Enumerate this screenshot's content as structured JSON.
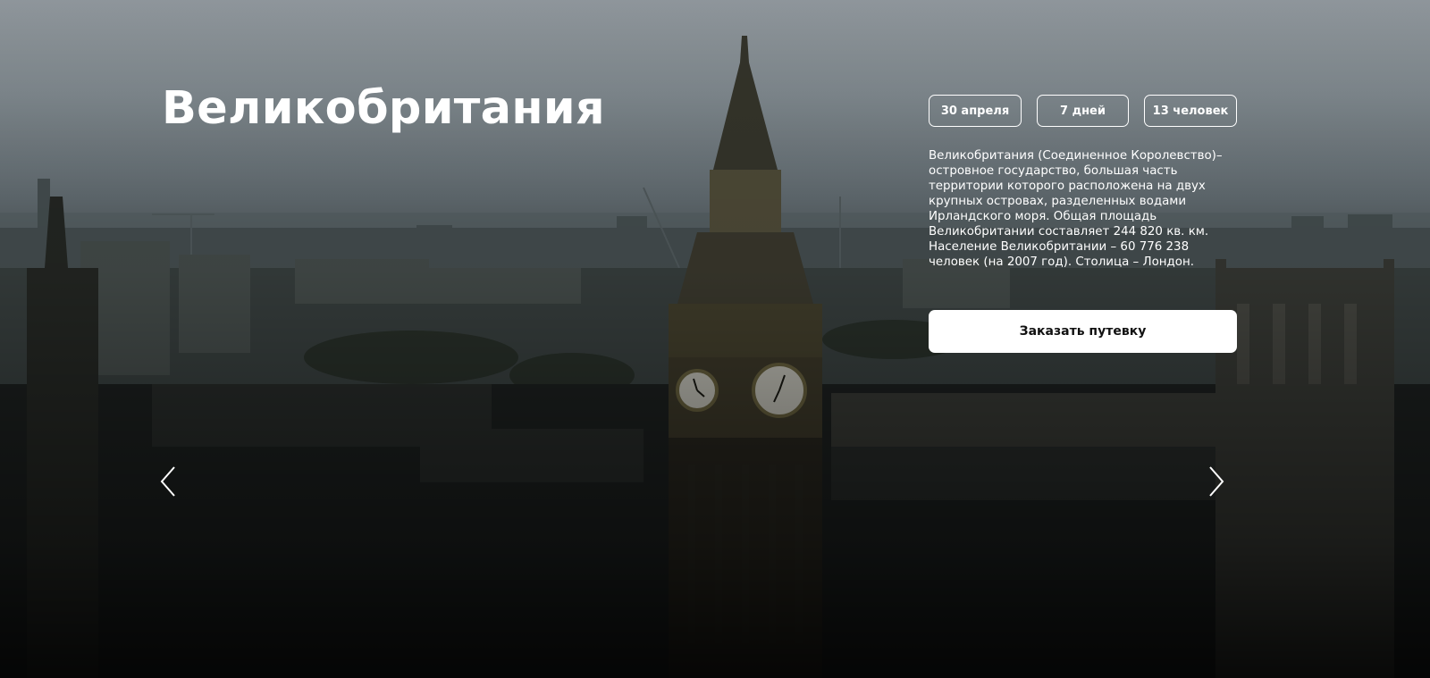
{
  "hero": {
    "title": "Великобритания",
    "badges": {
      "date": "30 апреля",
      "duration": "7 дней",
      "people": "13 человек"
    },
    "description": "Великобритания (Соединенное Королевство)– островное государство, большая часть территории которого расположена на двух крупных островах, разделенных водами Ирландского моря. Общая площадь Великобритании составляет 244 820 кв. км. Население Великобритании – 60 776 238 человек (на 2007 год). Столица – Лондон.",
    "order_button_label": "Заказать путевку"
  },
  "icons": {
    "prev": "chevron-left-icon",
    "next": "chevron-right-icon"
  },
  "colors": {
    "text": "#ffffff",
    "button_bg": "#ffffff",
    "button_text": "#111111",
    "sky_top": "#a2aab0",
    "ground_bottom": "#080909"
  }
}
